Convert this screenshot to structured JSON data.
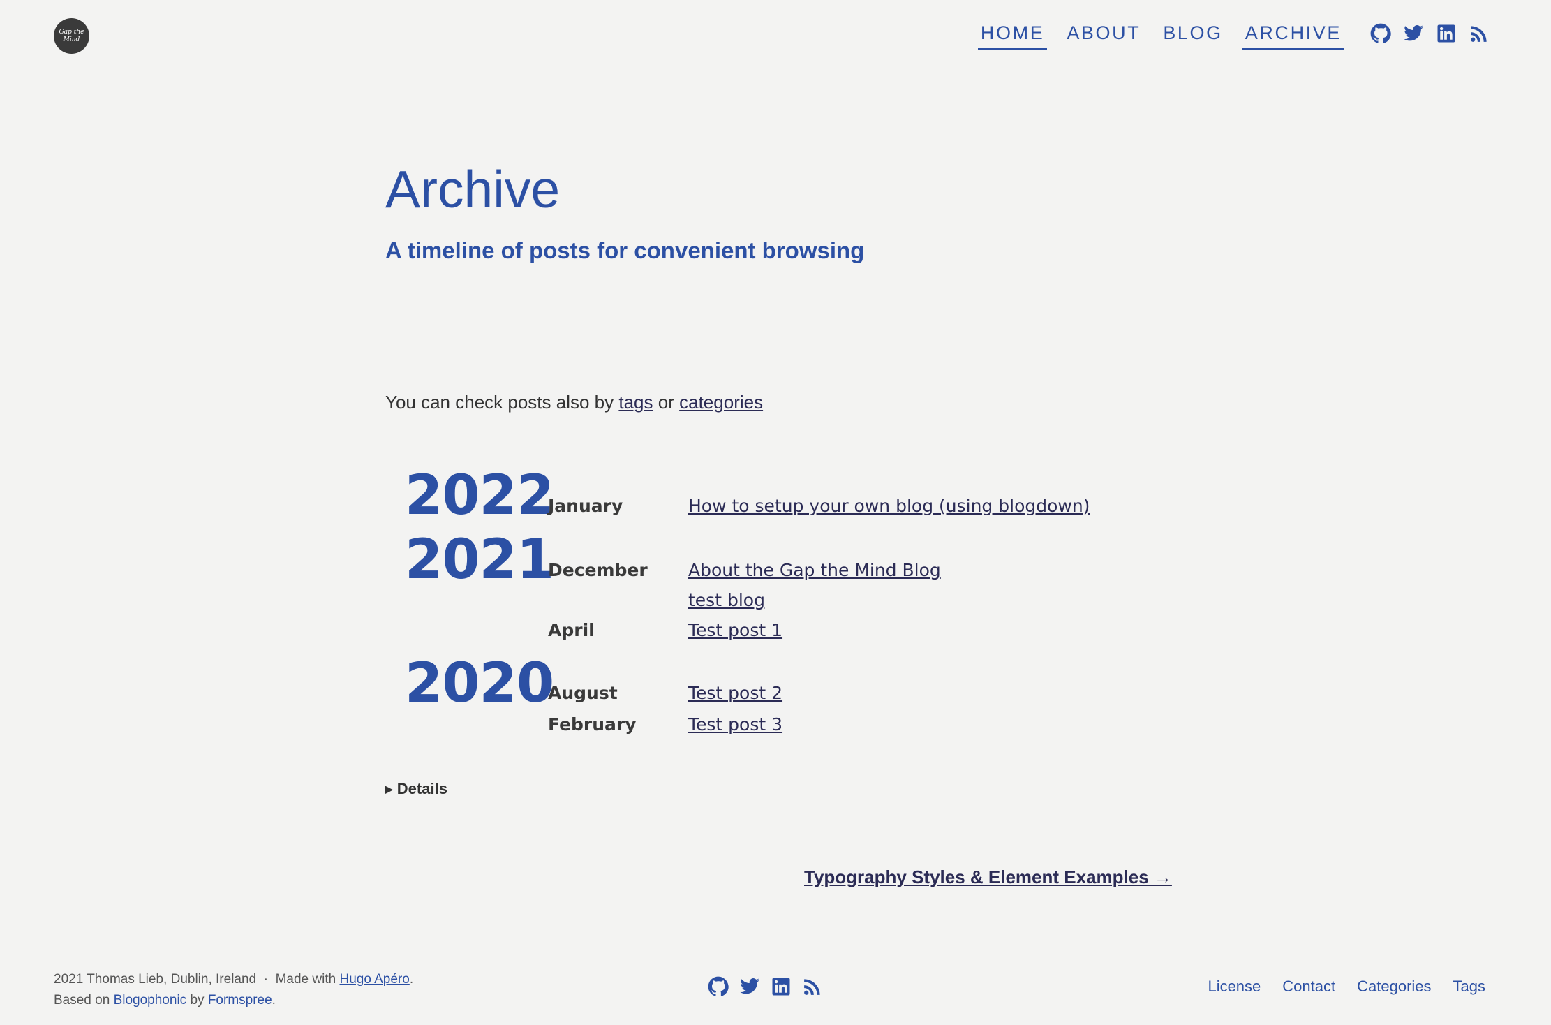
{
  "header": {
    "logo_text": "Gap the Mind",
    "nav": [
      {
        "label": "HOME",
        "active": true
      },
      {
        "label": "ABOUT",
        "active": false
      },
      {
        "label": "BLOG",
        "active": false
      },
      {
        "label": "ARCHIVE",
        "active": true
      }
    ],
    "social_icons": [
      "github-icon",
      "twitter-icon",
      "linkedin-icon",
      "rss-icon"
    ]
  },
  "page": {
    "title": "Archive",
    "subtitle": "A timeline of posts for convenient browsing",
    "intro_prefix": "You can check posts also by",
    "intro_tags": "tags",
    "intro_or": "or",
    "intro_categories": "categories"
  },
  "archive": [
    {
      "year": "2022",
      "months": [
        {
          "month": "January",
          "posts": [
            "How to setup your own blog (using blogdown)"
          ]
        }
      ]
    },
    {
      "year": "2021",
      "months": [
        {
          "month": "December",
          "posts": [
            "About the Gap the Mind Blog",
            "test blog"
          ]
        },
        {
          "month": "April",
          "posts": [
            "Test post 1"
          ]
        }
      ]
    },
    {
      "year": "2020",
      "months": [
        {
          "month": "August",
          "posts": [
            "Test post 2"
          ]
        },
        {
          "month": "February",
          "posts": [
            "Test post 3"
          ]
        }
      ]
    }
  ],
  "details_label": "Details",
  "next_post": "Typography Styles & Element Examples →",
  "footer": {
    "copyright": "2021 Thomas Lieb, Dublin, Ireland",
    "separator": "·",
    "made_with": "Made with",
    "hugo_link": "Hugo Apéro",
    "based_on": "Based on",
    "blogophonic_link": "Blogophonic",
    "by": "by",
    "formspree_link": "Formspree",
    "links": [
      "License",
      "Contact",
      "Categories",
      "Tags"
    ]
  },
  "colors": {
    "accent": "#2c50a4",
    "background": "#f3f3f2",
    "link_dark": "#2b2b55"
  }
}
